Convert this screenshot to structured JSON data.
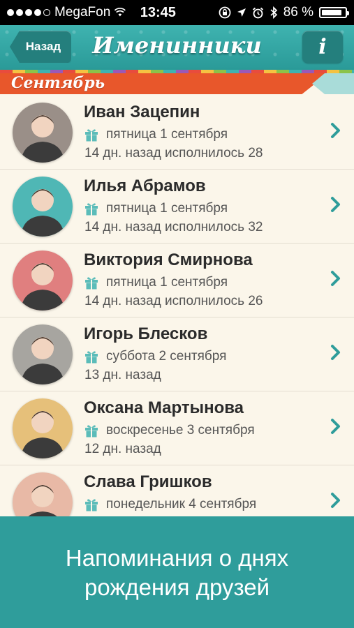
{
  "status_bar": {
    "carrier": "MegaFon",
    "time": "13:45",
    "battery": "86 %",
    "battery_level": 0.86
  },
  "nav": {
    "back_label": "Назад",
    "title": "Именинники",
    "info_label": "i"
  },
  "section": {
    "title": "Сентябрь"
  },
  "contacts": [
    {
      "name": "Иван Зацепин",
      "date": "пятница 1 сентября",
      "ago": "14 дн. назад исполнилось 28",
      "avatar_color": "#9a8f88"
    },
    {
      "name": "Илья Абрамов",
      "date": "пятница 1 сентября",
      "ago": "14 дн. назад исполнилось 32",
      "avatar_color": "#4fb7b5"
    },
    {
      "name": "Виктория Смирнова",
      "date": "пятница 1 сентября",
      "ago": "14 дн. назад исполнилось 26",
      "avatar_color": "#e07f7f"
    },
    {
      "name": "Игорь Блесков",
      "date": "суббота 2 сентября",
      "ago": "13 дн. назад",
      "avatar_color": "#a7a5a0"
    },
    {
      "name": "Оксана Мартынова",
      "date": "воскресенье 3 сентября",
      "ago": "12 дн. назад",
      "avatar_color": "#e6c07a"
    },
    {
      "name": "Слава Гришков",
      "date": "понедельник 4 сентября",
      "ago": "",
      "avatar_color": "#e8b9a6"
    }
  ],
  "banner": {
    "line1": "Напоминания о днях",
    "line2": "рождения друзей"
  },
  "colors": {
    "accent": "#2f9d9b",
    "ribbon": "#e8572b",
    "gift_icon": "#5bbcb9"
  }
}
